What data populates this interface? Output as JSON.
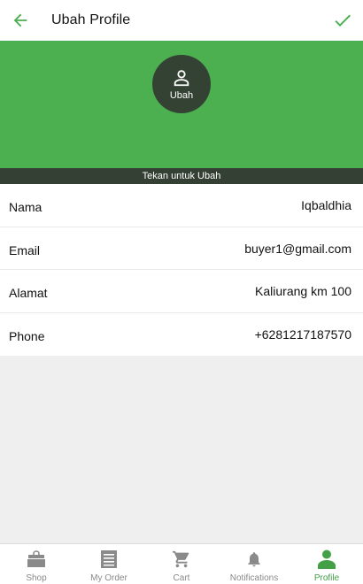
{
  "header": {
    "title": "Ubah Profile",
    "back_icon": "arrow-left-icon",
    "confirm_icon": "check-icon",
    "accent": "#4caf50"
  },
  "profile": {
    "avatar_icon": "person-icon",
    "avatar_label": "Ubah",
    "change_prompt": "Tekan untuk Ubah",
    "hero_color": "#4caf50",
    "avatar_color": "#344234"
  },
  "fields": [
    {
      "label": "Nama",
      "value": "Iqbaldhia"
    },
    {
      "label": "Email",
      "value": "buyer1@gmail.com"
    },
    {
      "label": "Alamat",
      "value": "Kaliurang km 100"
    },
    {
      "label": "Phone",
      "value": "+6281217187570"
    }
  ],
  "nav": {
    "items": [
      {
        "label": "Shop",
        "icon": "shopping-bag-icon"
      },
      {
        "label": "My Order",
        "icon": "receipt-list-icon"
      },
      {
        "label": "Cart",
        "icon": "cart-icon"
      },
      {
        "label": "Notifications",
        "icon": "bell-icon"
      },
      {
        "label": "Profile",
        "icon": "person-icon",
        "active": true
      }
    ],
    "active_color": "#43a047",
    "inactive_color": "#8a8a8a"
  }
}
